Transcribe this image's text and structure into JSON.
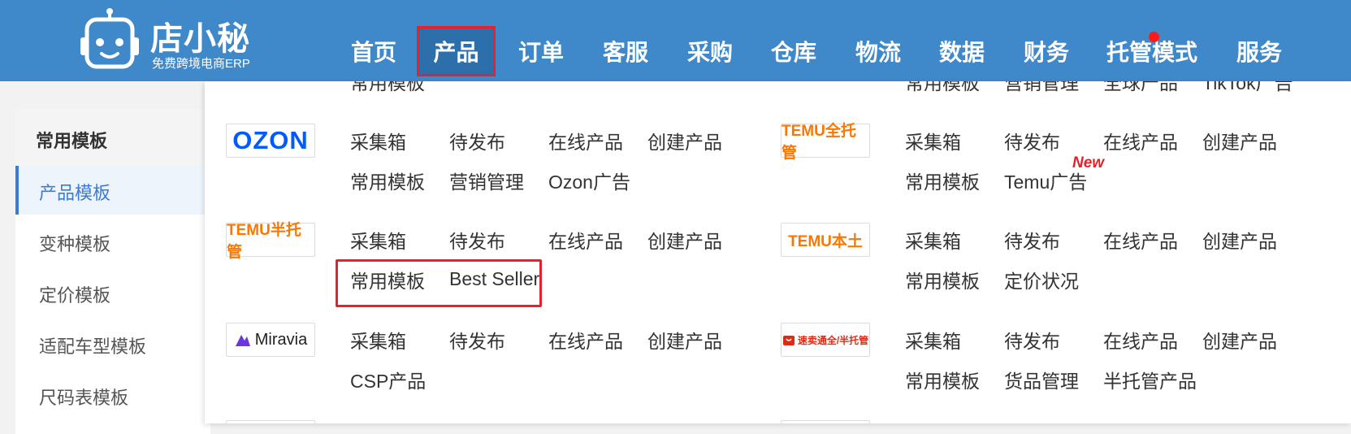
{
  "logo": {
    "title": "店小秘",
    "subtitle": "免费跨境电商ERP"
  },
  "nav": [
    "首页",
    "产品",
    "订单",
    "客服",
    "采购",
    "仓库",
    "物流",
    "数据",
    "财务",
    "托管模式",
    "服务"
  ],
  "nav_active": "产品",
  "sidebar": {
    "heading": "常用模板",
    "items": [
      "产品模板",
      "变种模板",
      "定价模板",
      "适配车型模板",
      "尺码表模板"
    ],
    "active": "产品模板"
  },
  "menu": {
    "top_left": [
      "常用模板"
    ],
    "top_right": [
      "常用模板",
      "营销管理",
      "全球产品",
      "TikTok广告"
    ],
    "ozon": {
      "logo": "OZON",
      "row1": [
        "采集箱",
        "待发布",
        "在线产品",
        "创建产品"
      ],
      "row2": [
        "常用模板",
        "营销管理",
        "Ozon广告"
      ]
    },
    "temu_full": {
      "logo": "TEMU全托管",
      "row1": [
        "采集箱",
        "待发布",
        "在线产品",
        "创建产品"
      ],
      "row2": [
        "常用模板",
        "Temu广告"
      ],
      "badge": "New"
    },
    "temu_half": {
      "logo": "TEMU半托管",
      "row1": [
        "采集箱",
        "待发布",
        "在线产品",
        "创建产品"
      ],
      "row2": [
        "常用模板",
        "Best Seller"
      ]
    },
    "temu_local": {
      "logo": "TEMU本土",
      "row1": [
        "采集箱",
        "待发布",
        "在线产品",
        "创建产品"
      ],
      "row2": [
        "常用模板",
        "定价状况"
      ]
    },
    "miravia": {
      "logo": "Miravia",
      "row1": [
        "采集箱",
        "待发布",
        "在线产品",
        "创建产品"
      ],
      "row2": [
        "CSP产品"
      ]
    },
    "aliexpress": {
      "logo": "速卖通全/半托管",
      "row1": [
        "采集箱",
        "待发布",
        "在线产品",
        "创建产品"
      ],
      "row2": [
        "常用模板",
        "货品管理",
        "半托管产品"
      ]
    }
  },
  "colors": {
    "header": "#3f88c9",
    "highlight": "#e8202a",
    "accent": "#3a7bd5",
    "temu": "#fb7701",
    "ozon": "#005bff"
  }
}
